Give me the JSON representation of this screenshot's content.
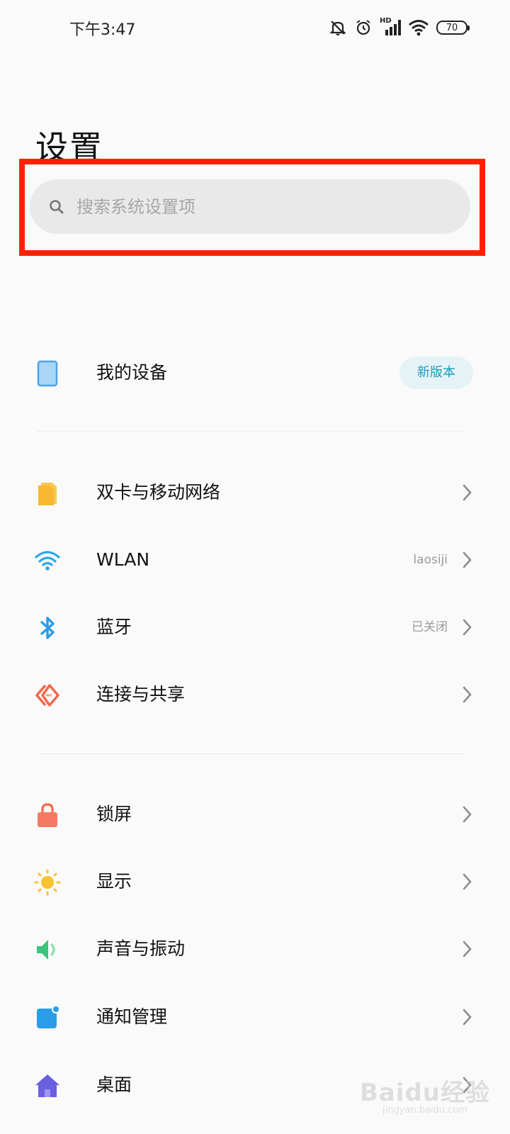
{
  "status_bar": {
    "time": "下午3:47",
    "signal_tag": "HD",
    "battery": "70"
  },
  "page": {
    "title": "设置"
  },
  "search": {
    "placeholder": "搜索系统设置项"
  },
  "section1": [
    {
      "label": "我的设备",
      "badge": "新版本",
      "icon": "tablet-icon",
      "color": "#4aa3e8"
    }
  ],
  "section2": [
    {
      "label": "双卡与移动网络",
      "value": "",
      "icon": "sim-card-icon",
      "color": "#f7b731"
    },
    {
      "label": "WLAN",
      "value": "laosiji",
      "icon": "wifi-icon",
      "color": "#29a8e8"
    },
    {
      "label": "蓝牙",
      "value": "已关闭",
      "icon": "bluetooth-icon",
      "color": "#2a9de8"
    },
    {
      "label": "连接与共享",
      "value": "",
      "icon": "connection-share-icon",
      "color": "#f2694c"
    }
  ],
  "section3": [
    {
      "label": "锁屏",
      "value": "",
      "icon": "lock-icon",
      "color": "#f2694c"
    },
    {
      "label": "显示",
      "value": "",
      "icon": "sun-icon",
      "color": "#f7c331"
    },
    {
      "label": "声音与振动",
      "value": "",
      "icon": "speaker-icon",
      "color": "#3cc47a"
    },
    {
      "label": "通知管理",
      "value": "",
      "icon": "notification-icon",
      "color": "#2a9de8"
    },
    {
      "label": "桌面",
      "value": "",
      "icon": "home-icon",
      "color": "#6a5fe0"
    }
  ],
  "watermark": {
    "main": "Baidu经验",
    "sub": "jingyan.baidu.com"
  }
}
